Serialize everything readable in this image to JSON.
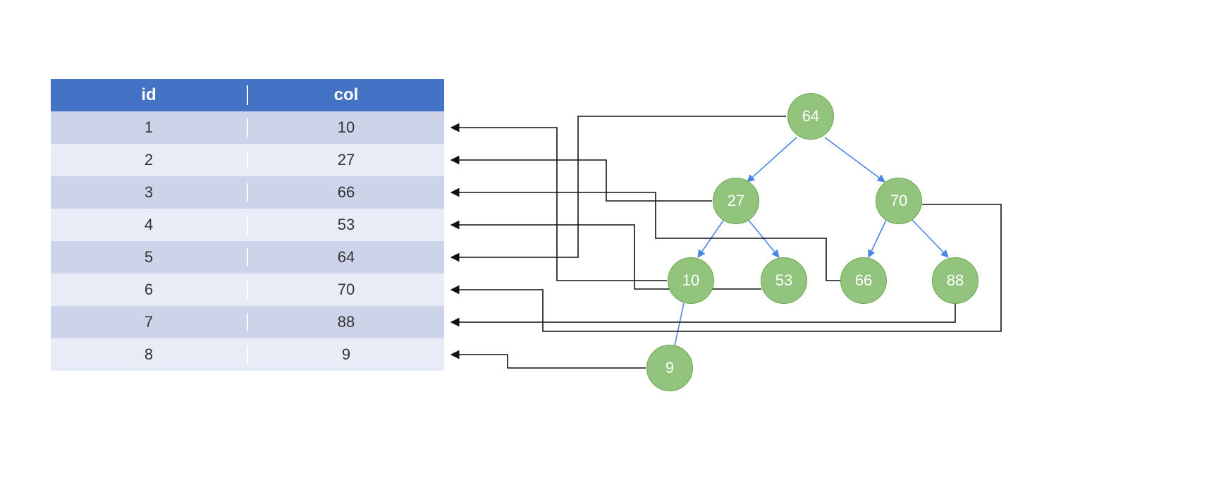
{
  "table": {
    "headers": {
      "id": "id",
      "col": "col"
    },
    "rows": [
      {
        "id": "1",
        "col": "10"
      },
      {
        "id": "2",
        "col": "27"
      },
      {
        "id": "3",
        "col": "66"
      },
      {
        "id": "4",
        "col": "53"
      },
      {
        "id": "5",
        "col": "64"
      },
      {
        "id": "6",
        "col": "70"
      },
      {
        "id": "7",
        "col": "88"
      },
      {
        "id": "8",
        "col": "9"
      }
    ]
  },
  "tree": {
    "nodes": {
      "root": {
        "label": "64"
      },
      "l": {
        "label": "27"
      },
      "r": {
        "label": "70"
      },
      "ll": {
        "label": "10"
      },
      "lr": {
        "label": "53"
      },
      "rl": {
        "label": "66"
      },
      "rr": {
        "label": "88"
      },
      "lll": {
        "label": "9"
      }
    }
  },
  "chart_data": {
    "type": "tree",
    "description": "Binary search tree with pointer edges back to table rows by value",
    "table": [
      {
        "id": 1,
        "col": 10
      },
      {
        "id": 2,
        "col": 27
      },
      {
        "id": 3,
        "col": 66
      },
      {
        "id": 4,
        "col": 53
      },
      {
        "id": 5,
        "col": 64
      },
      {
        "id": 6,
        "col": 70
      },
      {
        "id": 7,
        "col": 88
      },
      {
        "id": 8,
        "col": 9
      }
    ],
    "tree_nodes": [
      {
        "id": "root",
        "value": 64,
        "points_to_row_id": 5
      },
      {
        "id": "l",
        "value": 27,
        "points_to_row_id": 2
      },
      {
        "id": "r",
        "value": 70,
        "points_to_row_id": 6
      },
      {
        "id": "ll",
        "value": 10,
        "points_to_row_id": 1
      },
      {
        "id": "lr",
        "value": 53,
        "points_to_row_id": 4
      },
      {
        "id": "rl",
        "value": 66,
        "points_to_row_id": 3
      },
      {
        "id": "rr",
        "value": 88,
        "points_to_row_id": 7
      },
      {
        "id": "lll",
        "value": 9,
        "points_to_row_id": 8
      }
    ],
    "tree_edges": [
      [
        "root",
        "l"
      ],
      [
        "root",
        "r"
      ],
      [
        "l",
        "ll"
      ],
      [
        "l",
        "lr"
      ],
      [
        "r",
        "rl"
      ],
      [
        "r",
        "rr"
      ],
      [
        "ll",
        "lll"
      ]
    ]
  }
}
